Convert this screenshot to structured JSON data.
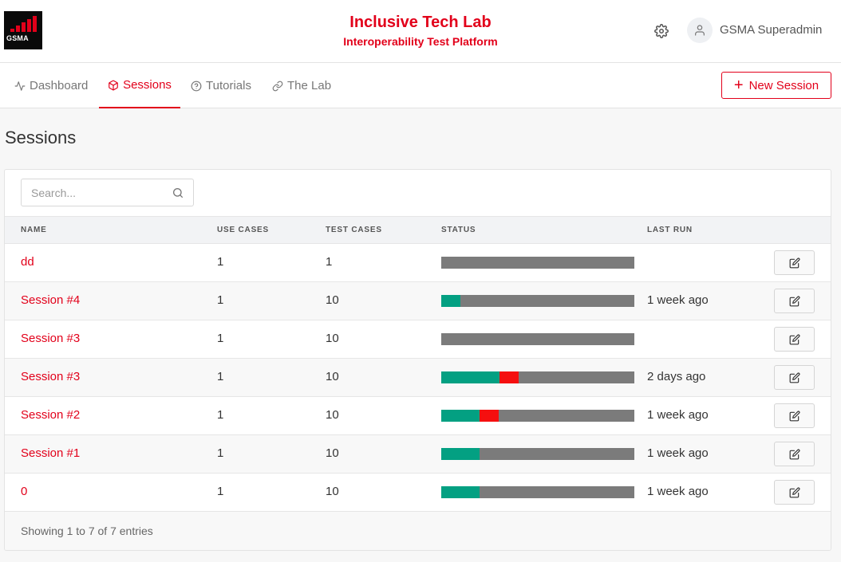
{
  "header": {
    "logo_text": "GSMA",
    "title": "Inclusive Tech Lab",
    "subtitle": "Interoperability Test Platform",
    "settings_icon": "gear-icon",
    "user_icon": "user-icon",
    "user_name": "GSMA Superadmin"
  },
  "nav": {
    "items": [
      {
        "label": "Dashboard",
        "icon": "activity-icon",
        "active": false
      },
      {
        "label": "Sessions",
        "icon": "cube-icon",
        "active": true
      },
      {
        "label": "Tutorials",
        "icon": "help-circle-icon",
        "active": false
      },
      {
        "label": "The Lab",
        "icon": "link-icon",
        "active": false
      }
    ],
    "new_session_label": "New Session"
  },
  "page": {
    "title": "Sessions"
  },
  "search": {
    "placeholder": "Search..."
  },
  "table": {
    "columns": [
      "NAME",
      "USE CASES",
      "TEST CASES",
      "STATUS",
      "LAST RUN"
    ],
    "rows": [
      {
        "name": "dd",
        "use_cases": "1",
        "test_cases": "1",
        "pass": 0,
        "fail": 0,
        "last_run": ""
      },
      {
        "name": "Session #4",
        "use_cases": "1",
        "test_cases": "10",
        "pass": 0.1,
        "fail": 0,
        "last_run": "1 week ago"
      },
      {
        "name": "Session #3",
        "use_cases": "1",
        "test_cases": "10",
        "pass": 0,
        "fail": 0,
        "last_run": ""
      },
      {
        "name": "Session #3",
        "use_cases": "1",
        "test_cases": "10",
        "pass": 0.3,
        "fail": 0.1,
        "last_run": "2 days ago"
      },
      {
        "name": "Session #2",
        "use_cases": "1",
        "test_cases": "10",
        "pass": 0.2,
        "fail": 0.1,
        "last_run": "1 week ago"
      },
      {
        "name": "Session #1",
        "use_cases": "1",
        "test_cases": "10",
        "pass": 0.2,
        "fail": 0,
        "last_run": "1 week ago"
      },
      {
        "name": "0",
        "use_cases": "1",
        "test_cases": "10",
        "pass": 0.2,
        "fail": 0,
        "last_run": "1 week ago"
      }
    ]
  },
  "footer": {
    "entries_text": "Showing 1 to 7 of 7 entries"
  },
  "colors": {
    "accent": "#e2001a",
    "pass": "#03a082",
    "fail": "#f50f0f",
    "pending": "#7b7b7b"
  }
}
